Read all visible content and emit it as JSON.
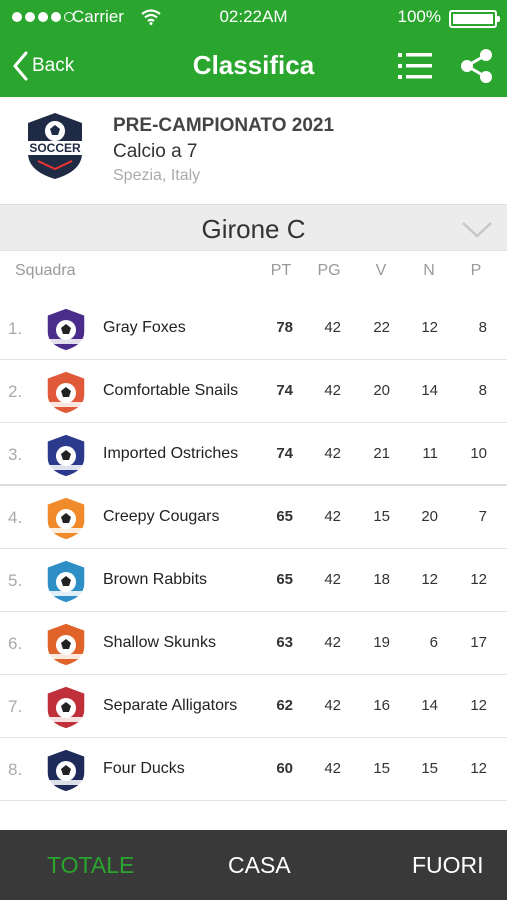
{
  "status_bar": {
    "carrier": "Carrier",
    "time": "02:22AM",
    "battery": "100%"
  },
  "nav": {
    "back_label": "Back",
    "title": "Classifica"
  },
  "competition": {
    "name": "PRE-CAMPIONATO 2021",
    "type": "Calcio a 7",
    "location": "Spezia, Italy",
    "logo_text": "SOCCER"
  },
  "group": {
    "label": "Girone C"
  },
  "table": {
    "headers": {
      "team": "Squadra",
      "pt": "PT",
      "pg": "PG",
      "v": "V",
      "n": "N",
      "p": "P"
    },
    "rows": [
      {
        "rank": "1.",
        "team": "Gray Foxes",
        "pt": "78",
        "pg": "42",
        "v": "22",
        "n": "12",
        "p": "8",
        "badge_color": "#4a2c8a"
      },
      {
        "rank": "2.",
        "team": "Comfortable Snails",
        "pt": "74",
        "pg": "42",
        "v": "20",
        "n": "14",
        "p": "8",
        "badge_color": "#e05a3a"
      },
      {
        "rank": "3.",
        "team": "Imported Ostriches",
        "pt": "74",
        "pg": "42",
        "v": "21",
        "n": "11",
        "p": "10",
        "badge_color": "#2b3a8c"
      },
      {
        "rank": "4.",
        "team": "Creepy Cougars",
        "pt": "65",
        "pg": "42",
        "v": "15",
        "n": "20",
        "p": "7",
        "badge_color": "#f08a2a"
      },
      {
        "rank": "5.",
        "team": "Brown Rabbits",
        "pt": "65",
        "pg": "42",
        "v": "18",
        "n": "12",
        "p": "12",
        "badge_color": "#2e8fc7"
      },
      {
        "rank": "6.",
        "team": "Shallow Skunks",
        "pt": "63",
        "pg": "42",
        "v": "19",
        "n": "6",
        "p": "17",
        "badge_color": "#e0632a"
      },
      {
        "rank": "7.",
        "team": "Separate Alligators",
        "pt": "62",
        "pg": "42",
        "v": "16",
        "n": "14",
        "p": "12",
        "badge_color": "#c0303a"
      },
      {
        "rank": "8.",
        "team": "Four Ducks",
        "pt": "60",
        "pg": "42",
        "v": "15",
        "n": "15",
        "p": "12",
        "badge_color": "#1e2a5a"
      }
    ]
  },
  "tabs": {
    "totale": "TOTALE",
    "casa": "CASA",
    "fuori": "FUORI"
  },
  "colors": {
    "accent": "#2aa52e",
    "tabbar": "#393939"
  }
}
